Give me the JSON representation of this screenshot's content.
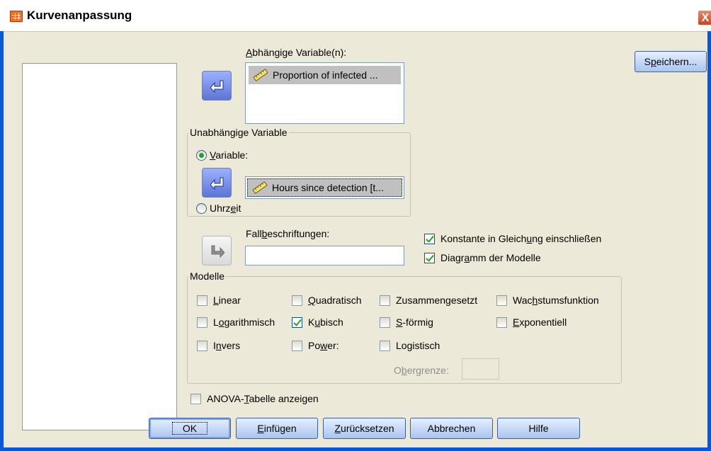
{
  "window": {
    "title": "Kurvenanpassung",
    "close_glyph": "X",
    "icon": "spss-grid-icon"
  },
  "dependent": {
    "label_pre": "",
    "label_u": "A",
    "label_post": "bhängige Variable(n):",
    "items": [
      {
        "icon": "scale-ruler-icon",
        "text": "Proportion of infected ..."
      }
    ]
  },
  "save_button": {
    "label_pre": "S",
    "label_u": "p",
    "label_post": "eichern..."
  },
  "independent": {
    "title": "Unabhängige Variable",
    "variable_option": {
      "label_pre": "",
      "label_u": "V",
      "label_post": "ariable:",
      "checked": true
    },
    "variable_value": {
      "icon": "scale-ruler-icon",
      "text": "Hours since detection [t..."
    },
    "time_option": {
      "label_pre": "Uhrz",
      "label_u": "e",
      "label_post": "it",
      "checked": false
    }
  },
  "case_labels": {
    "label_pre": "Fall",
    "label_u": "b",
    "label_post": "eschriftungen:",
    "value": ""
  },
  "options": {
    "include_constant": {
      "label_pre": "Konstante in Gleich",
      "label_u": "u",
      "label_post": "ng einschließen",
      "checked": true
    },
    "plot_models": {
      "label_pre": "Diagr",
      "label_u": "a",
      "label_post": "mm der Modelle",
      "checked": true
    }
  },
  "models": {
    "title": "Modelle",
    "linear": {
      "label_pre": "",
      "label_u": "L",
      "label_post": "inear",
      "checked": false
    },
    "logarithmic": {
      "label_pre": "L",
      "label_u": "o",
      "label_post": "garithmisch",
      "checked": false
    },
    "inverse": {
      "label_pre": "I",
      "label_u": "n",
      "label_post": "vers",
      "checked": false
    },
    "quadratic": {
      "label_pre": "",
      "label_u": "Q",
      "label_post": "uadratisch",
      "checked": false
    },
    "cubic": {
      "label_pre": "K",
      "label_u": "u",
      "label_post": "bisch",
      "checked": true
    },
    "power": {
      "label_pre": "Po",
      "label_u": "w",
      "label_post": "er:",
      "checked": false
    },
    "compound": {
      "label_pre": "Zusammen",
      "label_u": "g",
      "label_post": "esetzt",
      "checked": false
    },
    "s_shaped": {
      "label_pre": "",
      "label_u": "S",
      "label_post": "-förmig",
      "checked": false
    },
    "logistic": {
      "label_pre": "Lo",
      "label_u": "g",
      "label_post": "istisch",
      "checked": false
    },
    "growth": {
      "label_pre": "Wac",
      "label_u": "h",
      "label_post": "stumsfunktion",
      "checked": false
    },
    "exponential": {
      "label_pre": "",
      "label_u": "E",
      "label_post": "xponentiell",
      "checked": false
    },
    "upper_bound": {
      "label_pre": "O",
      "label_u": "b",
      "label_post": "ergrenze:",
      "value": ""
    }
  },
  "anova": {
    "label_pre": "ANOVA-",
    "label_u": "T",
    "label_post": "abelle anzeigen",
    "checked": false
  },
  "buttons": {
    "ok": "OK",
    "paste": {
      "label_pre": "",
      "label_u": "E",
      "label_post": "infügen"
    },
    "reset": {
      "label_pre": "",
      "label_u": "Z",
      "label_post": "urücksetzen"
    },
    "cancel": "Abbrechen",
    "help": "Hilfe"
  },
  "colors": {
    "frame_blue": "#0a56d6",
    "dialog_bg": "#ece9d8",
    "arrow_blue": "#5c75d7",
    "check_green": "#21a121"
  }
}
